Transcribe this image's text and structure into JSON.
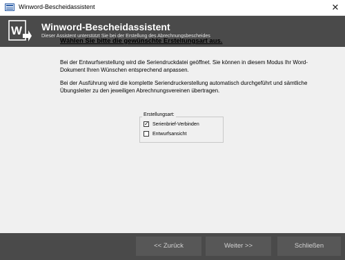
{
  "window": {
    "title": "Winword-Bescheidassistent",
    "close_glyph": "✕"
  },
  "banner": {
    "title": "Winword-Bescheidassistent",
    "subtitle": "Dieser Assistent unterstützt Sie bei der Erstellung des Abrechnungsbescheides",
    "logo_letter": "W"
  },
  "main": {
    "heading": "Wählen Sie bitte die gewünschte Erstellungsart aus.",
    "paragraph1": "Bei der Entwurfserstellung wird die Seriendruckdatei geöffnet. Sie können in diesem Modus Ihr Word-Dokument Ihren Wünschen entsprechend anpassen.",
    "paragraph2": "Bei der Ausführung wird die komplette Seriendruckerstellung automatisch durchgeführt und sämtliche Übungsleiter zu den jeweiligen Abrechnungsvereinen übertragen.",
    "group": {
      "legend": "Erstellungsart:",
      "options": [
        {
          "label": "Serienbrief-Verbinden",
          "checked": true
        },
        {
          "label": "Entwurfsansicht",
          "checked": false
        }
      ]
    }
  },
  "footer": {
    "back_label": "<< Zurück",
    "next_label": "Weiter >>",
    "close_label": "Schließen"
  }
}
